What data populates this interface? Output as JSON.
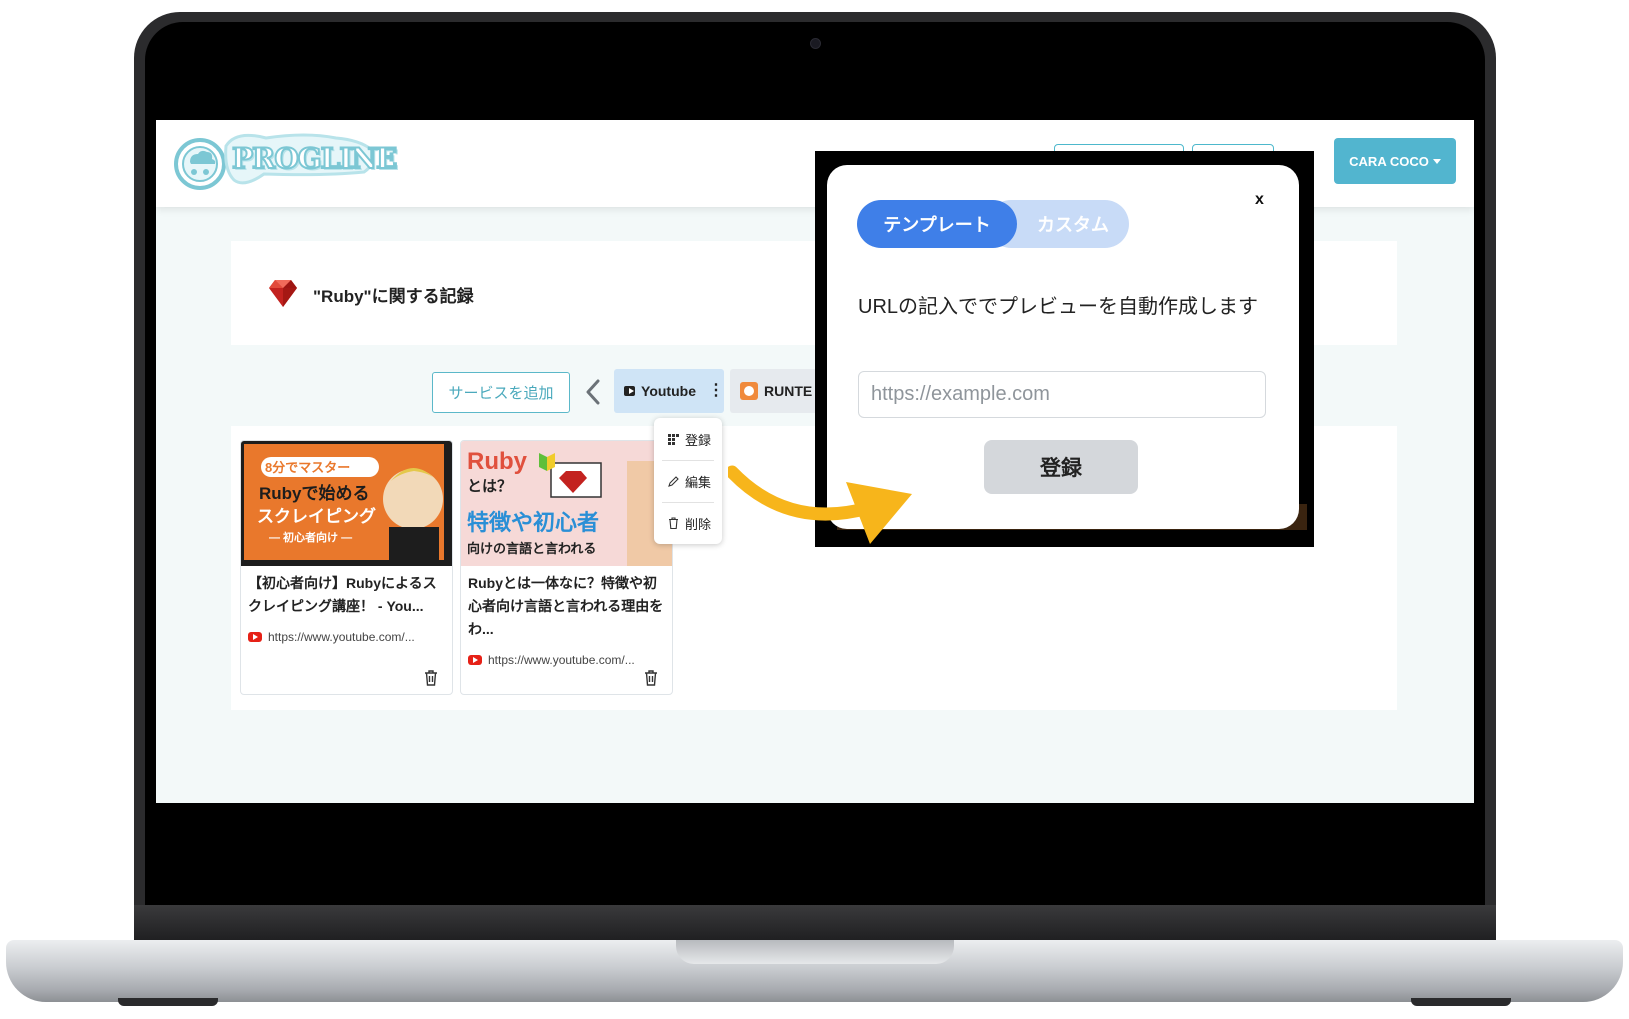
{
  "app": {
    "logo_text": "PROGLINE",
    "user_menu_label": "CARA COCO"
  },
  "heading": {
    "title": "\"Ruby\"に関する記録"
  },
  "services": {
    "add_button_label": "サービスを追加",
    "tabs": [
      {
        "label": "Youtube",
        "active": true
      },
      {
        "label": "RUNTE",
        "active": false
      }
    ]
  },
  "context_menu": {
    "items": [
      {
        "label": "登録",
        "icon": "grid-icon"
      },
      {
        "label": "編集",
        "icon": "pencil-icon"
      },
      {
        "label": "削除",
        "icon": "trash-icon"
      }
    ]
  },
  "cards": [
    {
      "thumb_top": "8分でマスター",
      "thumb_line1": "Rubyで始める",
      "thumb_line2": "スクレイピング",
      "thumb_line3": "― 初心者向け ―",
      "title": "【初心者向け】Rubyによるスクレイピング講座！ - You...",
      "url": "https://www.youtube.com/..."
    },
    {
      "thumb_word": "Ruby",
      "thumb_sub": "とは？",
      "thumb_big": "特徴や初心者",
      "thumb_foot": "向けの言語と言われる",
      "title": "Rubyとは一体なに？特徴や初心者向け言語と言われる理由をわ...",
      "url": "https://www.youtube.com/..."
    }
  ],
  "modal": {
    "tab_template": "テンプレート",
    "tab_custom": "カスタム",
    "close_label": "x",
    "description": "URLの記入ででプレビューを自動作成します",
    "input_placeholder": "https://example.com",
    "input_value": "",
    "submit_label": "登録"
  },
  "colors": {
    "accent": "#52b5cf",
    "primary_blue": "#3f7fe8",
    "arrow": "#f7b51b",
    "youtube_red": "#e62117"
  }
}
